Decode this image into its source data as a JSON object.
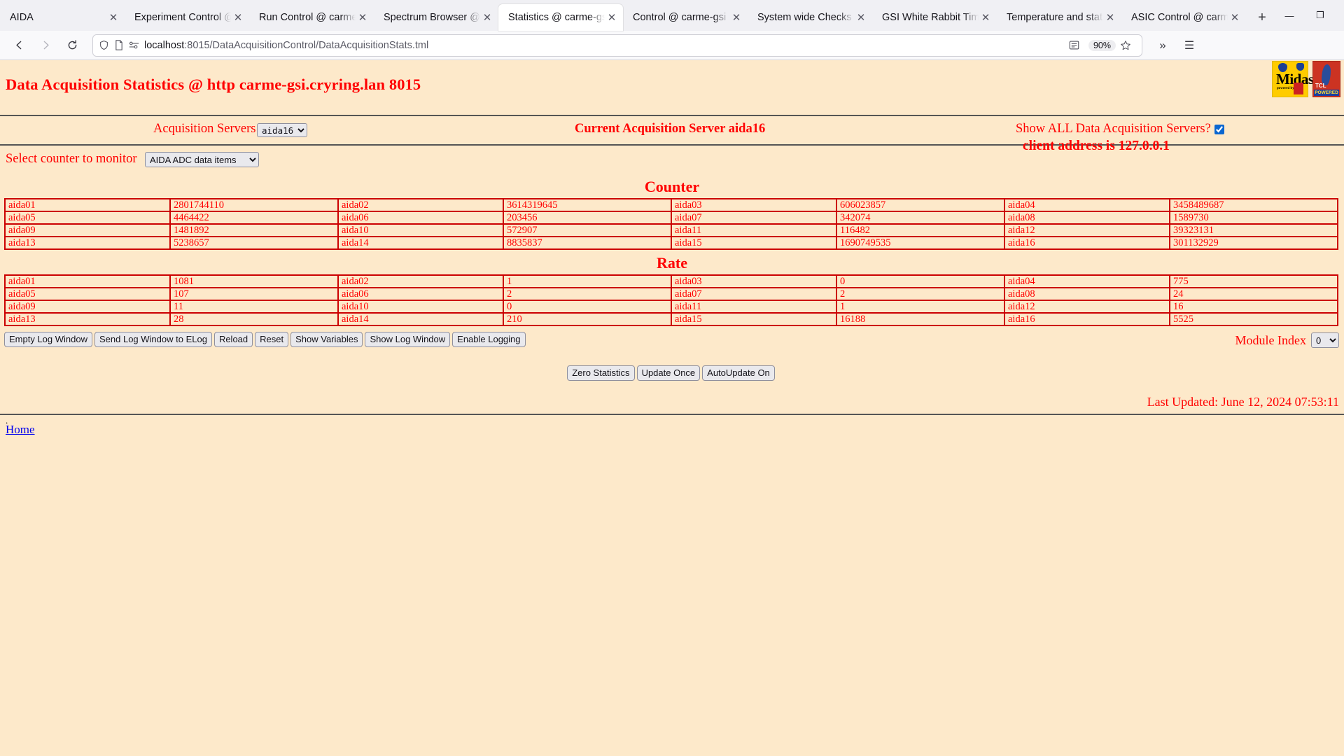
{
  "browser": {
    "tabs": [
      {
        "label": "AIDA",
        "active": false
      },
      {
        "label": "Experiment Control @",
        "active": false
      },
      {
        "label": "Run Control @ carme",
        "active": false
      },
      {
        "label": "Spectrum Browser @",
        "active": false
      },
      {
        "label": "Statistics @ carme-gsi",
        "active": true
      },
      {
        "label": "Control @ carme-gsi",
        "active": false
      },
      {
        "label": "System wide Checks (",
        "active": false
      },
      {
        "label": "GSI White Rabbit Tim",
        "active": false
      },
      {
        "label": "Temperature and stat",
        "active": false
      },
      {
        "label": "ASIC Control @ carm",
        "active": false
      }
    ],
    "new_tab_label": "+",
    "close_glyph": "✕",
    "window_controls": {
      "minimize": "—",
      "maximize": "❐",
      "close": "✕"
    },
    "nav": {
      "back": "←",
      "forward": "→",
      "reload": "↻",
      "url_host": "localhost",
      "url_path": ":8015/DataAcquisitionControl/DataAcquisitionStats.tml",
      "zoom_level": "90%",
      "bookmark_star": "☆",
      "reader_icon": "reader-view",
      "overflow": "»",
      "menu": "☰"
    }
  },
  "page": {
    "title": "Data Acquisition Statistics @ http carme-gsi.cryring.lan 8015",
    "client_address": "client address is 127.0.0.1",
    "acquisition_servers_label": "Acquisition Servers",
    "acquisition_server_value": "aida16",
    "current_server": "Current Acquisition Server aida16",
    "show_all_label": "Show ALL Data Acquisition Servers?",
    "show_all_checked": true,
    "select_counter_label": "Select counter to monitor",
    "counter_select_value": "AIDA ADC data items",
    "counter_table_title": "Counter",
    "rate_table_title": "Rate",
    "counter_rows": [
      [
        "aida01",
        "2801744110",
        "aida02",
        "3614319645",
        "aida03",
        "606023857",
        "aida04",
        "3458489687"
      ],
      [
        "aida05",
        "4464422",
        "aida06",
        "203456",
        "aida07",
        "342074",
        "aida08",
        "1589730"
      ],
      [
        "aida09",
        "1481892",
        "aida10",
        "572907",
        "aida11",
        "116482",
        "aida12",
        "39323131"
      ],
      [
        "aida13",
        "5238657",
        "aida14",
        "8835837",
        "aida15",
        "1690749535",
        "aida16",
        "301132929"
      ]
    ],
    "rate_rows": [
      [
        "aida01",
        "1081",
        "aida02",
        "1",
        "aida03",
        "0",
        "aida04",
        "775"
      ],
      [
        "aida05",
        "107",
        "aida06",
        "2",
        "aida07",
        "2",
        "aida08",
        "24"
      ],
      [
        "aida09",
        "11",
        "aida10",
        "0",
        "aida11",
        "1",
        "aida12",
        "16"
      ],
      [
        "aida13",
        "28",
        "aida14",
        "210",
        "aida15",
        "16188",
        "aida16",
        "5525"
      ]
    ],
    "log_buttons": [
      "Empty Log Window",
      "Send Log Window to ELog",
      "Reload",
      "Reset",
      "Show Variables",
      "Show Log Window",
      "Enable Logging"
    ],
    "module_index_label": "Module Index",
    "module_index_value": "0",
    "action_buttons": [
      "Zero Statistics",
      "Update Once",
      "AutoUpdate On"
    ],
    "last_updated": "Last Updated: June 12, 2024 07:53:11",
    "home_link": "Home",
    "colors": {
      "bg": "#fde9ca",
      "text": "#ff0000",
      "table_border": "#cc0000",
      "link": "#0000ee"
    }
  }
}
